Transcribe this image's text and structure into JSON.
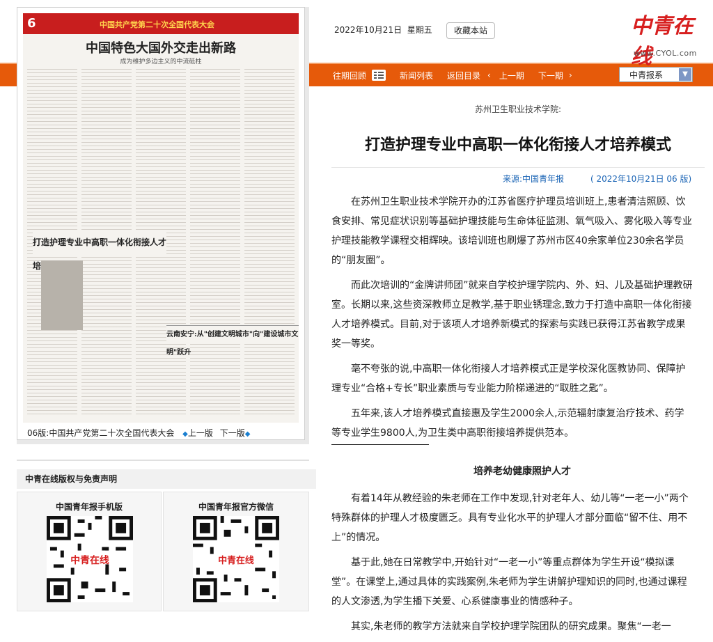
{
  "header": {
    "date": "2022年10月21日",
    "weekday": "星期五",
    "favorite_label": "收藏本站",
    "logo_text": "中青在线",
    "logo_domain": "www.CYOL.com"
  },
  "nav": {
    "past_issues": "往期回顾",
    "news_list": "新闻列表",
    "back_to_index": "返回目录",
    "prev_issue": "上一期",
    "next_issue": "下一期",
    "paper_select_value": "中青报系"
  },
  "left": {
    "paper_page_no": "6",
    "paper_banner": "中国共产党第二十次全国代表大会",
    "paper_headline": "中国特色大国外交走出新路",
    "paper_subheadline": "成为维护多边主义的中流砥柱",
    "paper_article": "打造护理专业中高职一体化衔接人才培养模式",
    "paper_article2": "云南安宁:从\"创建文明城市\"向\"建设城市文明\"跃升",
    "page_caption": "06版:中国共产党第二十次全国代表大会",
    "prev_page": "上一版",
    "next_page": "下一版",
    "copyright": "中青在线版权与免责声明",
    "qr1_title": "中国青年报手机版",
    "qr2_title": "中国青年报官方微信"
  },
  "article": {
    "supertitle": "苏州卫生职业技术学院:",
    "title": "打造护理专业中高职一体化衔接人才培养模式",
    "source": "来源:中国青年报",
    "date_page": "( 2022年10月21日   06 版)",
    "paragraphs": [
      "在苏州卫生职业技术学院开办的江苏省医疗护理员培训班上,患者清洁照顾、饮食安排、常见症状识别等基础护理技能与生命体征监测、氧气吸入、雾化吸入等专业护理技能教学课程交相辉映。该培训班也刷爆了苏州市区40余家单位230余名学员的“朋友圈”。",
      "而此次培训的“金牌讲师团”就来自学校护理学院内、外、妇、儿及基础护理教研室。长期以来,这些资深教师立足教学,基于职业锈理念,致力于打造中高职一体化衔接人才培养模式。目前,对于该项人才培养新模式的探索与实践已获得江苏省教学成果奖一等奖。",
      "毫不夸张的说,中高职一体化衔接人才培养模式正是学校深化医教协同、保障护理专业“合格+专长”职业素质与专业能力阶梯递进的“取胜之匙”。",
      "五年来,该人才培养模式直接惠及学生2000余人,示范辐射康复治疗技术、药学等专业学生9800人,为卫生类中高职衔接培养提供范本。"
    ],
    "subheading": "培养老幼健康照护人才",
    "paragraphs2": [
      "有着14年从教经验的朱老师在工作中发现,针对老年人、幼儿等“一老一小”两个特殊群体的护理人才极度匮乏。具有专业化水平的护理人才部分面临“留不住、用不上”的情况。",
      "基于此,她在日常教学中,开始针对“一老一小”等重点群体为学生开设“模拟课堂”。在课堂上,通过具体的实践案例,朱老师为学生讲解护理知识的同时,也通过课程的人文渗透,为学生播下关爱、心系健康事业的情感种子。",
      "其实,朱老师的教学方法就来自学校护理学院团队的研究成果。聚焦“一老一"
    ]
  }
}
